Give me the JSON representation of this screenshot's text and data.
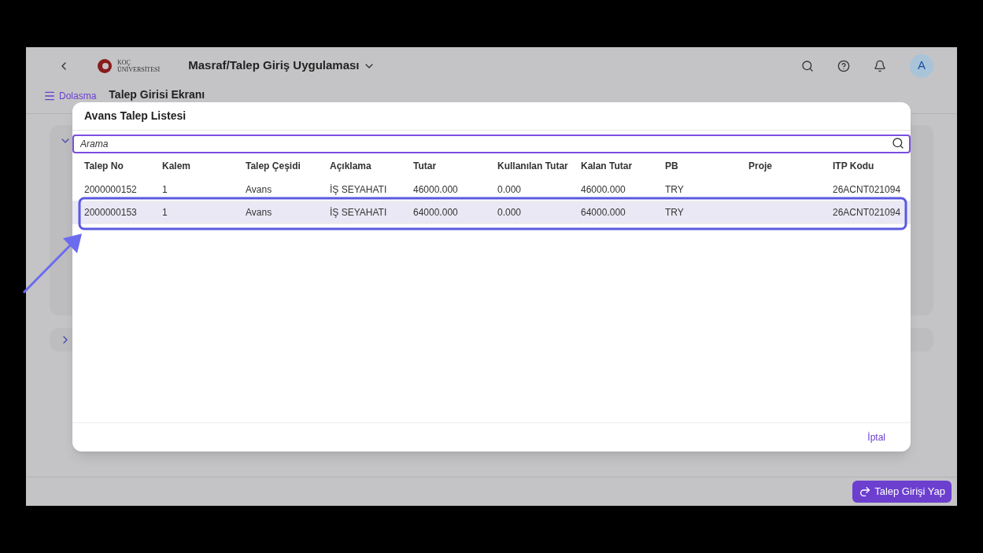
{
  "shell": {
    "logo": {
      "line1": "KOÇ",
      "line2": "ÜNİVERSİTESİ"
    },
    "app_title": "Masraf/Talep Giriş Uygulaması",
    "avatar": "A"
  },
  "subheader": {
    "nav_label": "Dolasma",
    "page_title": "Talep Girisi Ekranı"
  },
  "footer": {
    "primary_button": "Talep Girişi Yap"
  },
  "dialog": {
    "title": "Avans Talep Listesi",
    "search": {
      "placeholder": "Arama"
    },
    "table": {
      "columns": [
        "Talep No",
        "Kalem",
        "Talep Çeşidi",
        "Açıklama",
        "Tutar",
        "Kullanılan Tutar",
        "Kalan Tutar",
        "PB",
        "Proje",
        "ITP Kodu"
      ],
      "rows": [
        {
          "selected": false,
          "cells": [
            "2000000152",
            "1",
            "Avans",
            "İŞ SEYAHATI",
            "46000.000",
            "0.000",
            "46000.000",
            "TRY",
            "",
            "26ACNT021094"
          ]
        },
        {
          "selected": true,
          "cells": [
            "2000000153",
            "1",
            "Avans",
            "İŞ SEYAHATI",
            "64000.000",
            "0.000",
            "64000.000",
            "TRY",
            "",
            "26ACNT021094"
          ]
        }
      ]
    },
    "cancel_button": "İptal"
  }
}
